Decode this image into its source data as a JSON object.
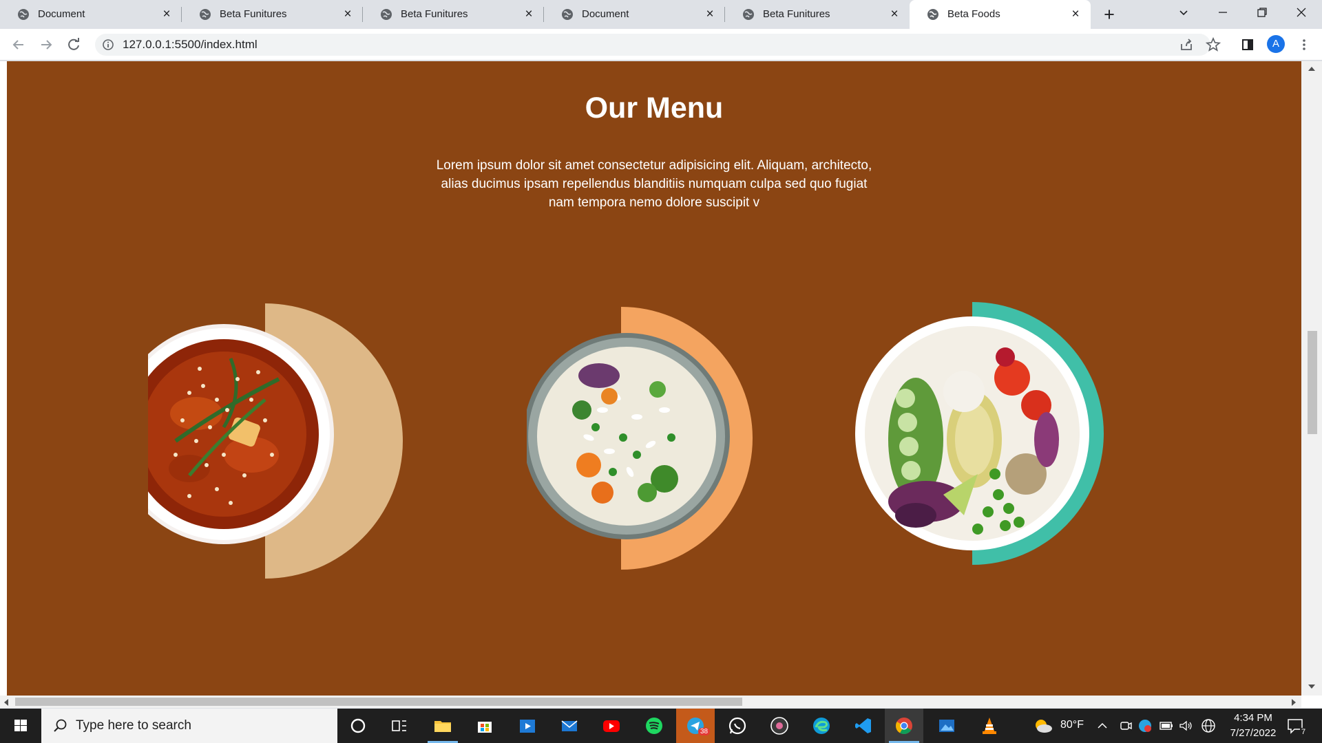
{
  "browser": {
    "tabs": [
      {
        "title": "Document"
      },
      {
        "title": "Beta Funitures"
      },
      {
        "title": "Beta Funitures"
      },
      {
        "title": "Document"
      },
      {
        "title": "Beta Funitures"
      },
      {
        "title": "Beta Foods"
      }
    ],
    "active_tab_index": 5,
    "address": "127.0.0.1:5500/index.html",
    "profile_initial": "A"
  },
  "page": {
    "title": "Our Menu",
    "description": "Lorem ipsum dolor sit amet consectetur adipisicing elit. Aliquam, architecto, alias ducimus ipsam repellendus blanditiis numquam culpa sed quo fugiat nam tempora nemo dolore suscipit v",
    "background_color": "#8b4513",
    "dishes": [
      {
        "name": "soup",
        "accent_color": "#deb887"
      },
      {
        "name": "rice-bowl",
        "accent_color": "#f4a460"
      },
      {
        "name": "salad-bowl",
        "accent_color": "#40bfa8"
      }
    ]
  },
  "taskbar": {
    "search_placeholder": "Type here to search",
    "telegram_badge": "38",
    "weather": "80°F",
    "time": "4:34 PM",
    "date": "7/27/2022",
    "notification_count": "7"
  }
}
